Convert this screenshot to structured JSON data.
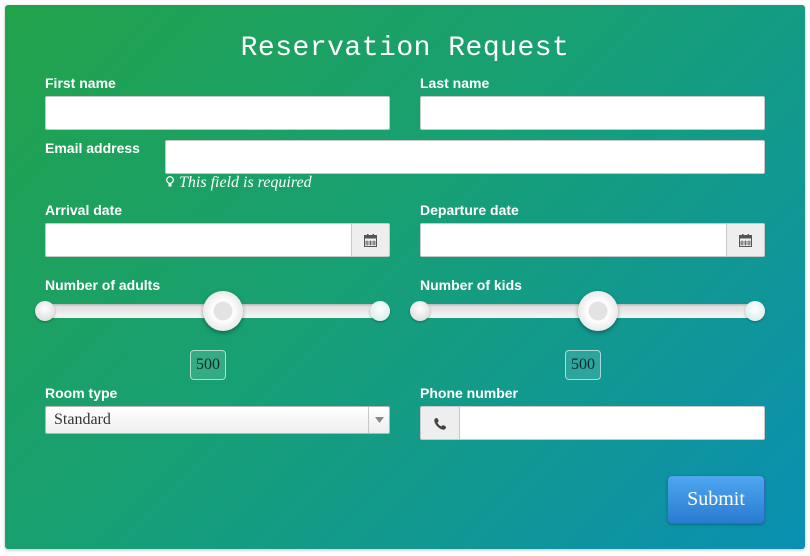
{
  "form": {
    "title": "Reservation Request",
    "first_name": {
      "label": "First name",
      "value": ""
    },
    "last_name": {
      "label": "Last name",
      "value": ""
    },
    "email": {
      "label": "Email address",
      "value": "",
      "hint": "This field is required"
    },
    "arrival": {
      "label": "Arrival date",
      "value": ""
    },
    "departure": {
      "label": "Departure date",
      "value": ""
    },
    "adults": {
      "label": "Number of adults",
      "value": "500",
      "level": 0.5
    },
    "kids": {
      "label": "Number of kids",
      "value": "500",
      "level": 0.5
    },
    "room_type": {
      "label": "Room type",
      "selected": "Standard"
    },
    "phone": {
      "label": "Phone number",
      "value": ""
    },
    "submit_label": "Submit"
  },
  "icons": {
    "calendar": "calendar-icon",
    "phone": "phone-icon",
    "hint": "lightbulb-icon",
    "dropdown": "triangle-down-icon"
  },
  "colors": {
    "gradient_start": "#22a24a",
    "gradient_end": "#0a8fb3",
    "submit": "#3a90e0"
  }
}
